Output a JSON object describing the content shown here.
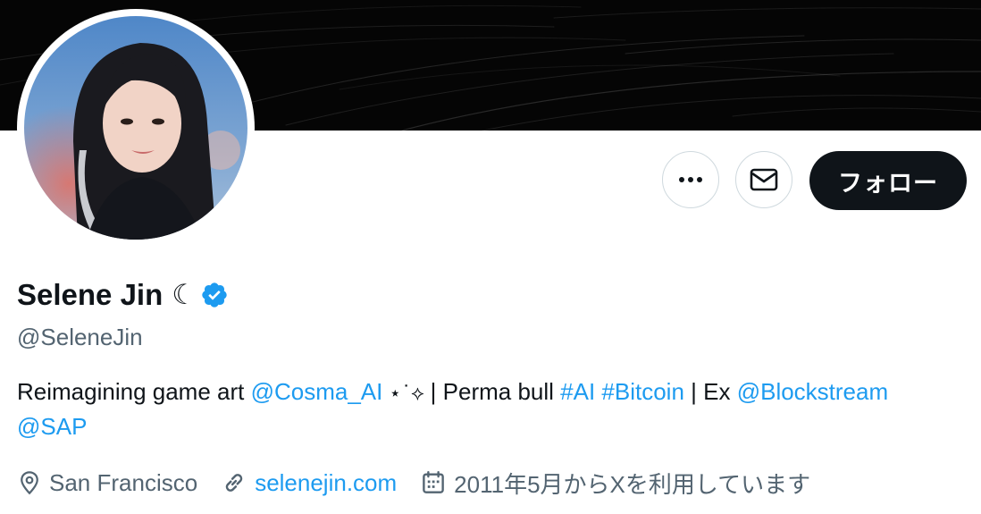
{
  "profile": {
    "name": "Selene Jin",
    "name_emoji": "☾",
    "handle": "@SeleneJin",
    "verified": true,
    "bio": {
      "text_1": "Reimagining game art ",
      "mention_1": "@Cosma_AI",
      "sparkles": " ⋆˙⟡ ",
      "text_2": "| Perma bull ",
      "hashtag_1": "#AI",
      "hashtag_2": "#Bitcoin",
      "text_3": " | Ex ",
      "mention_2": "@Blockstream",
      "mention_3": "@SAP"
    },
    "location": "San Francisco",
    "website": "selenejin.com",
    "joined": "2011年5月からXを利用しています"
  },
  "actions": {
    "more_icon": "more-dots-icon",
    "message_icon": "mail-icon",
    "follow_label": "フォロー"
  },
  "colors": {
    "accent": "#1d9bf0",
    "text_primary": "#0f1419",
    "text_secondary": "#536471",
    "follow_bg": "#0f1419",
    "banner_bg": "#050505"
  }
}
